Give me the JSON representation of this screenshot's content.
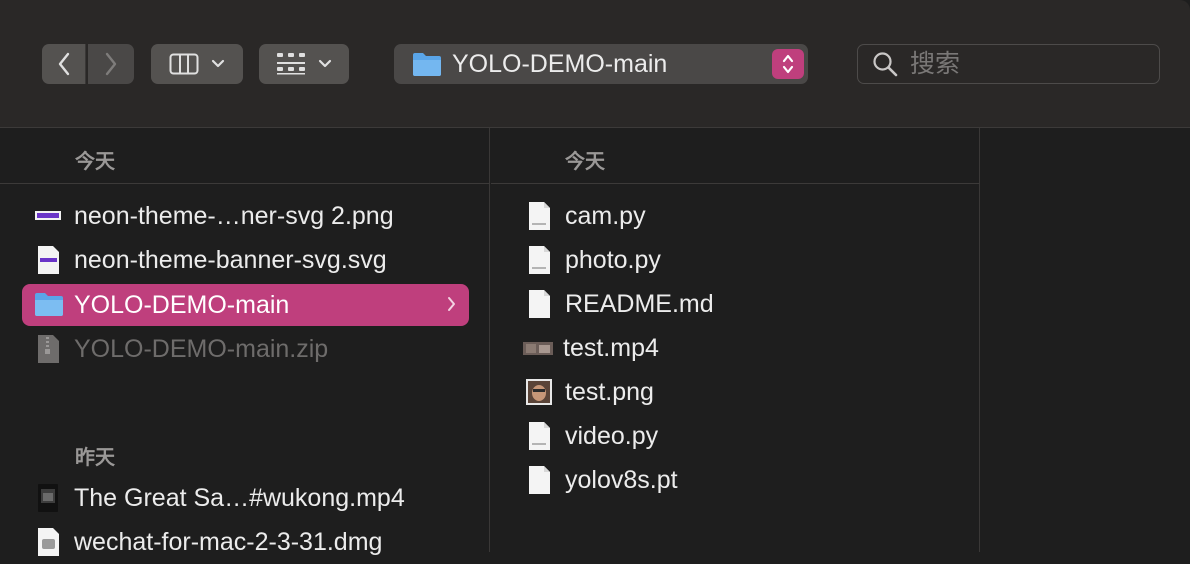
{
  "toolbar": {
    "path_label": "YOLO-DEMO-main",
    "search_placeholder": "搜索"
  },
  "column1": {
    "sections": [
      {
        "header": "今天",
        "items": [
          {
            "name": "neon-theme-…ner-svg 2.png",
            "icon": "png-banner-icon"
          },
          {
            "name": "neon-theme-banner-svg.svg",
            "icon": "svg-document-icon"
          },
          {
            "name": "YOLO-DEMO-main",
            "icon": "folder-icon",
            "selected": true
          },
          {
            "name": "YOLO-DEMO-main.zip",
            "icon": "zip-archive-icon",
            "dim": true
          }
        ]
      },
      {
        "header": "昨天",
        "items": [
          {
            "name": "The Great Sa…#wukong.mp4",
            "icon": "video-thumbnail-icon"
          },
          {
            "name": "wechat-for-mac-2-3-31.dmg",
            "icon": "disk-image-icon"
          }
        ]
      }
    ]
  },
  "column2": {
    "header": "今天",
    "items": [
      {
        "name": "cam.py",
        "icon": "python-file-icon"
      },
      {
        "name": "photo.py",
        "icon": "python-file-icon"
      },
      {
        "name": "README.md",
        "icon": "document-icon"
      },
      {
        "name": "test.mp4",
        "icon": "video-thumbnail-icon"
      },
      {
        "name": "test.png",
        "icon": "image-thumbnail-icon"
      },
      {
        "name": "video.py",
        "icon": "python-file-icon"
      },
      {
        "name": "yolov8s.pt",
        "icon": "document-icon"
      }
    ]
  },
  "colors": {
    "accent": "#bf3f7d",
    "folder": "#5aa5e8",
    "background": "#1e1e1e",
    "toolbar": "#2a2827"
  }
}
